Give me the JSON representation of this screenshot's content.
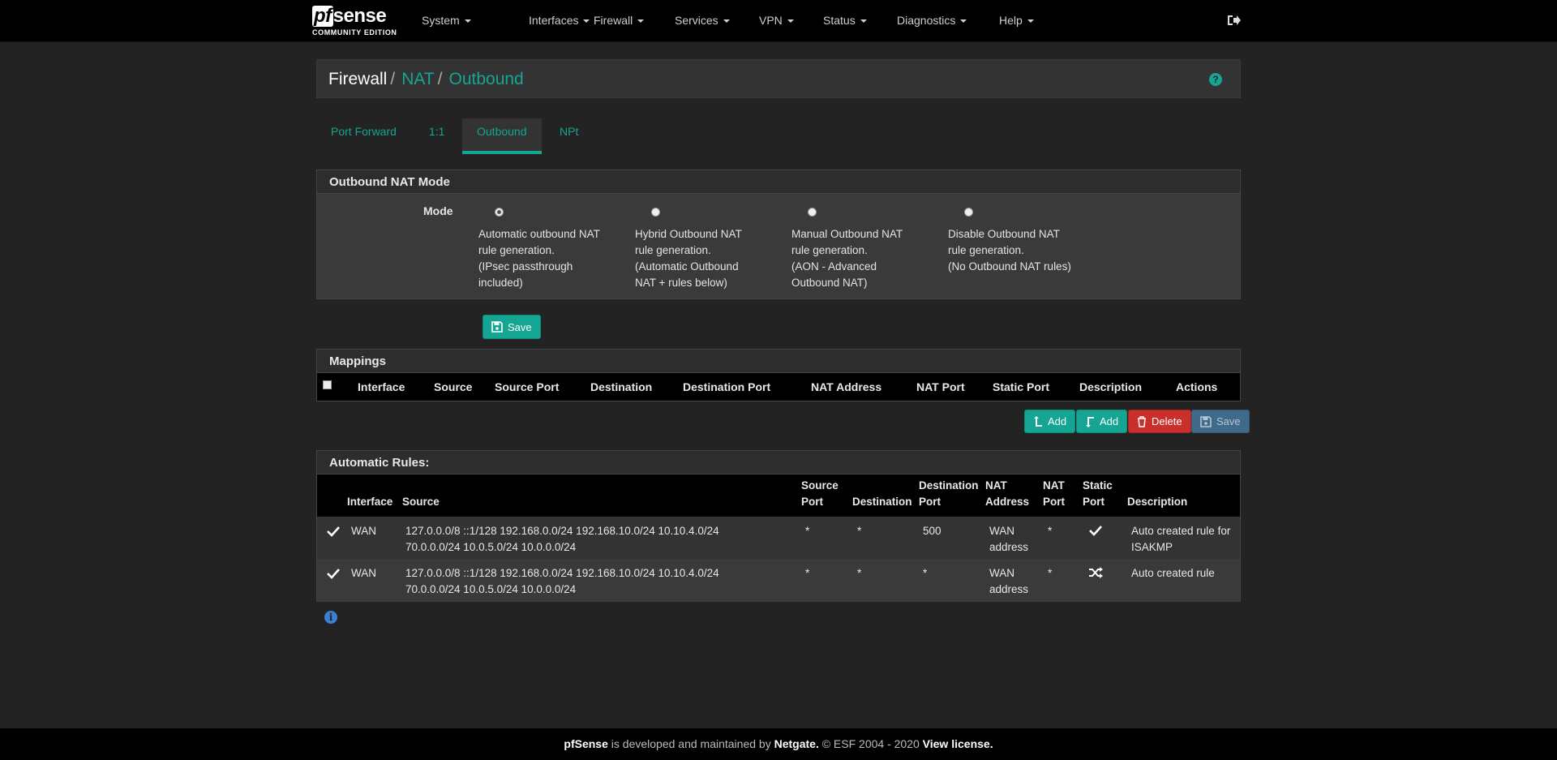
{
  "nav": {
    "logo_main": "sense",
    "logo_pf": "pf",
    "logo_sub": "COMMUNITY EDITION",
    "items": [
      "System",
      "Interfaces",
      "Firewall",
      "Services",
      "VPN",
      "Status",
      "Diagnostics",
      "Help"
    ]
  },
  "breadcrumb": {
    "first": "Firewall",
    "second": "NAT",
    "third": "Outbound",
    "sep": "/"
  },
  "tabs": [
    "Port Forward",
    "1:1",
    "Outbound",
    "NPt"
  ],
  "mode_panel": {
    "title": "Outbound NAT Mode",
    "label": "Mode",
    "options": [
      {
        "lines": [
          "Automatic outbound NAT",
          "rule generation.",
          "(IPsec passthrough",
          "included)"
        ],
        "checked": true
      },
      {
        "lines": [
          "Hybrid Outbound NAT",
          "rule generation.",
          "(Automatic Outbound",
          "NAT + rules below)"
        ],
        "checked": false
      },
      {
        "lines": [
          "Manual Outbound NAT",
          "rule generation.",
          "(AON - Advanced",
          "Outbound NAT)"
        ],
        "checked": false
      },
      {
        "lines": [
          "Disable Outbound NAT",
          "rule generation.",
          "(No Outbound NAT rules)"
        ],
        "checked": false
      }
    ],
    "save_label": "Save"
  },
  "mappings": {
    "title": "Mappings",
    "columns": [
      "Interface",
      "Source",
      "Source Port",
      "Destination",
      "Destination Port",
      "NAT Address",
      "NAT Port",
      "Static Port",
      "Description",
      "Actions"
    ],
    "buttons": {
      "add_top": "Add",
      "add_bottom": "Add",
      "delete": "Delete",
      "save": "Save"
    }
  },
  "auto_rules": {
    "title": "Automatic Rules:",
    "columns": {
      "interface": "Interface",
      "source": "Source",
      "source_port": [
        "Source",
        "Port"
      ],
      "destination": "Destination",
      "destination_port": [
        "Destination",
        "Port"
      ],
      "nat_address": [
        "NAT",
        "Address"
      ],
      "nat_port": [
        "NAT",
        "Port"
      ],
      "static_port": [
        "Static",
        "Port"
      ],
      "description": "Description"
    },
    "rows": [
      {
        "interface": "WAN",
        "source": [
          "127.0.0.0/8 ::1/128 192.168.0.0/24 192.168.10.0/24 10.10.4.0/24",
          "70.0.0.0/24 10.0.5.0/24 10.0.0.0/24"
        ],
        "source_port": "*",
        "destination": "*",
        "destination_port": "500",
        "nat_address": [
          "WAN",
          "address"
        ],
        "nat_port": "*",
        "static_port_icon": "check-icon",
        "description": [
          "Auto created rule for",
          "ISAKMP"
        ]
      },
      {
        "interface": "WAN",
        "source": [
          "127.0.0.0/8 ::1/128 192.168.0.0/24 192.168.10.0/24 10.10.4.0/24",
          "70.0.0.0/24 10.0.5.0/24 10.0.0.0/24"
        ],
        "source_port": "*",
        "destination": "*",
        "destination_port": "*",
        "nat_address": [
          "WAN",
          "address"
        ],
        "nat_port": "*",
        "static_port_icon": "shuffle-icon",
        "description": [
          "Auto created rule"
        ]
      }
    ]
  },
  "footer": {
    "brand": "pfSense",
    "text1": " is developed and maintained by ",
    "company": "Netgate.",
    "text2": " © ESF 2004 - 2020 ",
    "license": "View license."
  }
}
